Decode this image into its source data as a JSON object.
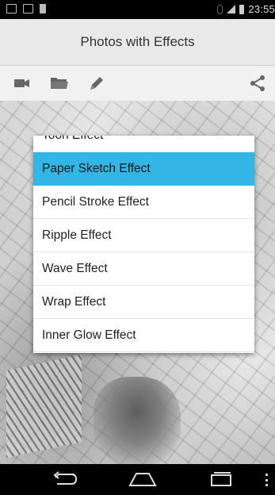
{
  "status_bar": {
    "time": "23:55",
    "left_icons": [
      "notification-icon",
      "gmail-icon",
      "sd-card-icon"
    ],
    "right_icons": [
      "alarm-icon",
      "signal-icon",
      "battery-icon"
    ]
  },
  "titlebar": {
    "title": "Photos with Effects"
  },
  "toolbar": {
    "icons": [
      "video-camera-icon",
      "folder-icon",
      "pencil-icon",
      "share-icon"
    ]
  },
  "menu": {
    "partial_item": "Toon Effect",
    "items": [
      {
        "label": "Paper Sketch Effect",
        "selected": true
      },
      {
        "label": "Pencil Stroke Effect",
        "selected": false
      },
      {
        "label": "Ripple Effect",
        "selected": false
      },
      {
        "label": "Wave Effect",
        "selected": false
      },
      {
        "label": "Wrap Effect",
        "selected": false
      },
      {
        "label": "Inner Glow Effect",
        "selected": false
      }
    ]
  },
  "navbar": {
    "icons": [
      "back-icon",
      "home-icon",
      "recent-apps-icon",
      "overflow-menu-icon"
    ]
  },
  "colors": {
    "accent": "#33b5e5",
    "titlebar_bg": "#e9e9e9",
    "icon": "#666666"
  }
}
